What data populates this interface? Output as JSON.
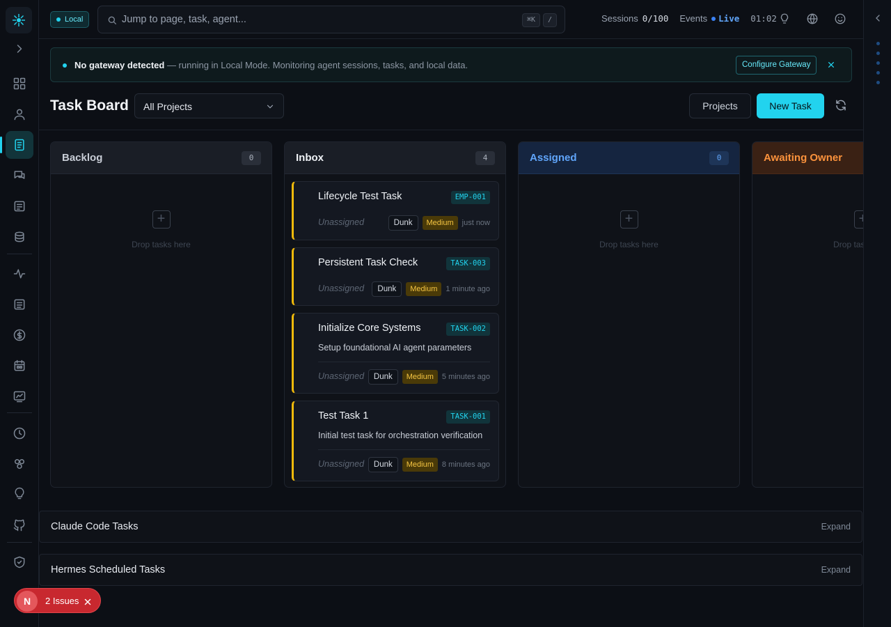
{
  "topbar": {
    "mode_pill": "Local",
    "search_placeholder": "Jump to page, task, agent...",
    "kbd_1": "⌘K",
    "kbd_2": "/",
    "sessions_label": "Sessions",
    "sessions_value": "0/100",
    "events_label": "Events",
    "events_status": "Live",
    "clock": "01:02"
  },
  "banner": {
    "title": "No gateway detected",
    "message": " — running in Local Mode. Monitoring agent sessions, tasks, and local data.",
    "configure_label": "Configure Gateway"
  },
  "header": {
    "title": "Task Board",
    "project_filter": "All Projects",
    "projects_button": "Projects",
    "new_task_button": "New Task"
  },
  "columns": [
    {
      "name": "Backlog",
      "count": "0",
      "empty_text": "Drop tasks here"
    },
    {
      "name": "Inbox",
      "count": "4",
      "empty_text": ""
    },
    {
      "name": "Assigned",
      "count": "0",
      "empty_text": "Drop tasks here"
    },
    {
      "name": "Awaiting Owner",
      "count": "",
      "empty_text": "Drop tasks here"
    }
  ],
  "inbox_cards": [
    {
      "title": "Lifecycle Test Task",
      "id": "EMP-001",
      "description": "",
      "assignee": "Unassigned",
      "tag": "Dunk",
      "priority": "Medium",
      "time": "just now"
    },
    {
      "title": "Persistent Task Check",
      "id": "TASK-003",
      "description": "",
      "assignee": "Unassigned",
      "tag": "Dunk",
      "priority": "Medium",
      "time": "1 minute ago"
    },
    {
      "title": "Initialize Core Systems",
      "id": "TASK-002",
      "description": "Setup foundational AI agent parameters",
      "assignee": "Unassigned",
      "tag": "Dunk",
      "priority": "Medium",
      "time": "5 minutes ago"
    },
    {
      "title": "Test Task 1",
      "id": "TASK-001",
      "description": "Initial test task for orchestration verification",
      "assignee": "Unassigned",
      "tag": "Dunk",
      "priority": "Medium",
      "time": "8 minutes ago"
    }
  ],
  "sections": [
    {
      "title": "Claude Code Tasks",
      "action": "Expand"
    },
    {
      "title": "Hermes Scheduled Tasks",
      "action": "Expand"
    }
  ],
  "issues": {
    "avatar": "N",
    "label": "2 Issues"
  },
  "colors": {
    "accent": "#22d3ee",
    "priority_border": "#f0b90b",
    "assigned": "#60a5fa",
    "awaiting": "#fb923c",
    "issues": "#c8282f"
  }
}
